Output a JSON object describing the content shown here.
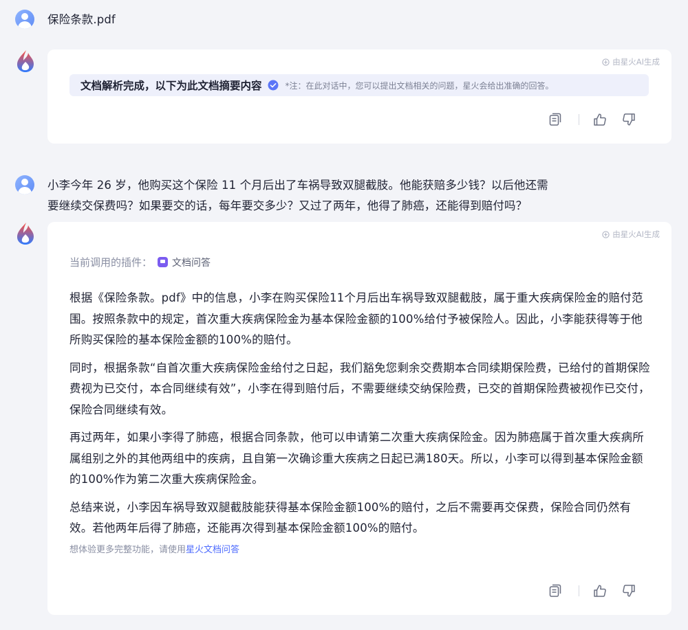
{
  "file_message": {
    "text": "保险条款.pdf"
  },
  "card1": {
    "ai_tag": "由星火AI生成",
    "summary_title": "文档解析完成，以下为此文档摘要内容",
    "summary_note": "*注：在此对话中，您可以提出文档相关的问题，星火会给出准确的回答。"
  },
  "user_question": {
    "line1": "小李今年 26 岁，他购买这个保险 11 个月后出了车祸导致双腿截肢。他能获赔多少钱？以后他还需",
    "line2": "要继续交保费吗？如果要交的话，每年要交多少？又过了两年，他得了肺癌，还能得到赔付吗？"
  },
  "card2": {
    "ai_tag": "由星火AI生成",
    "plugin_label": "当前调用的插件：",
    "plugin_name": "文档问答",
    "paragraphs": [
      "根据《保险条款。pdf》中的信息，小李在购买保险11个月后出车祸导致双腿截肢，属于重大疾病保险金的赔付范围。按照条款中的规定，首次重大疾病保险金为基本保险金额的100%给付予被保险人。因此，小李能获得等于他所购买保险的基本保险金额的100%的赔付。",
      "同时，根据条款“自首次重大疾病保险金给付之日起，我们豁免您剩余交费期本合同续期保险费，已给付的首期保险费视为已交付，本合同继续有效”，小李在得到赔付后，不需要继续交纳保险费，已交的首期保险费被视作已交付，保险合同继续有效。",
      "再过两年，如果小李得了肺癌，根据合同条款，他可以申请第二次重大疾病保险金。因为肺癌属于首次重大疾病所属组别之外的其他两组中的疾病，且自第一次确诊重大疾病之日起已满180天。所以，小李可以得到基本保险金额的100%作为第二次重大疾病保险金。",
      "总结来说，小李因车祸导致双腿截肢能获得基本保险金额100%的赔付，之后不需要再交保费，保险合同仍然有效。若他两年后得了肺癌，还能再次得到基本保险金额100%的赔付。"
    ],
    "footnote_prefix": "想体验更多完整功能，请使用",
    "footnote_link": "星火文档问答"
  },
  "icons": {
    "user_avatar": "user-avatar",
    "bot_avatar": "spark-flame-logo",
    "copy": "copy-icon",
    "like": "thumbs-up-icon",
    "dislike": "thumbs-down-icon",
    "verified": "check-circle-icon"
  },
  "colors": {
    "background": "#f3f4f8",
    "card": "#ffffff",
    "accent": "#4d6bfe",
    "summary_bg": "#eef0fb"
  }
}
